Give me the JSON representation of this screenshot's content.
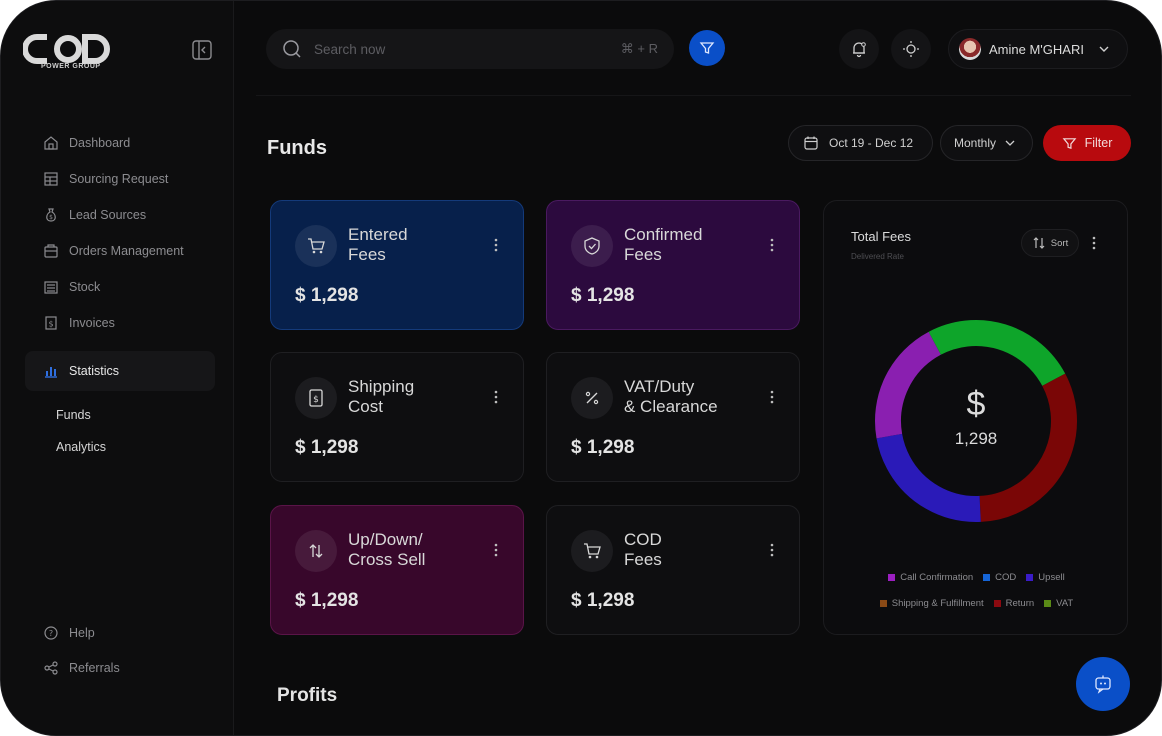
{
  "brand": {
    "logo_text": "COD",
    "logo_sub": "POWER GROUP"
  },
  "sidebar": {
    "items": [
      {
        "label": "Dashboard",
        "icon": "home-icon"
      },
      {
        "label": "Sourcing Request",
        "icon": "table-icon"
      },
      {
        "label": "Lead Sources",
        "icon": "money-bag-icon"
      },
      {
        "label": "Orders Management",
        "icon": "box-icon"
      },
      {
        "label": "Stock",
        "icon": "stock-icon"
      },
      {
        "label": "Invoices",
        "icon": "invoice-icon"
      },
      {
        "label": "Statistics",
        "icon": "chart-icon",
        "active": true
      }
    ],
    "sub_items": [
      {
        "label": "Funds"
      },
      {
        "label": "Analytics"
      }
    ],
    "footer_items": [
      {
        "label": "Help",
        "icon": "help-icon"
      },
      {
        "label": "Referrals",
        "icon": "share-icon"
      }
    ]
  },
  "header": {
    "search_placeholder": "Search now",
    "search_shortcut": "⌘ + R",
    "user_name": "Amine M'GHARI"
  },
  "funds": {
    "title": "Funds",
    "date_range": "Oct 19 - Dec 12",
    "period": "Monthly",
    "filter_label": "Filter"
  },
  "cards": [
    {
      "title_line1": "Entered",
      "title_line2": "Fees",
      "value": "$ 1,298",
      "icon": "cart-icon"
    },
    {
      "title_line1": "Confirmed",
      "title_line2": "Fees",
      "value": "$ 1,298",
      "icon": "shield-check-icon"
    },
    {
      "title_line1": "Shipping",
      "title_line2": "Cost",
      "value": "$ 1,298",
      "icon": "receipt-icon"
    },
    {
      "title_line1": "VAT/Duty",
      "title_line2": "& Clearance",
      "value": "$ 1,298",
      "icon": "percent-icon"
    },
    {
      "title_line1": "Up/Down/",
      "title_line2": "Cross Sell",
      "value": "$ 1,298",
      "icon": "arrows-updown-icon"
    },
    {
      "title_line1": "COD",
      "title_line2": "Fees",
      "value": "$ 1,298",
      "icon": "cart-icon"
    }
  ],
  "total_fees": {
    "title": "Total Fees",
    "subtitle": "Delivered Rate",
    "sort_label": "Sort",
    "center_symbol": "$",
    "center_value": "1,298"
  },
  "chart_data": {
    "type": "pie",
    "title": "Total Fees",
    "categories": [
      "Call Confirmation",
      "COD",
      "Upsell",
      "Shipping & Fulfillment",
      "Return",
      "VAT"
    ],
    "legend_colors": [
      "#9b1fc0",
      "#1565d8",
      "#3a1cc8",
      "#8a4a16",
      "#8b0a10",
      "#5a8a16"
    ],
    "donut_segments": [
      {
        "name": "green",
        "value": 25,
        "color": "#0ea52a"
      },
      {
        "name": "dark-red",
        "value": 32,
        "color": "#7a0606"
      },
      {
        "name": "indigo",
        "value": 23,
        "color": "#2a1ab8"
      },
      {
        "name": "purple",
        "value": 20,
        "color": "#8a1fb0"
      }
    ]
  },
  "profits": {
    "title": "Profits"
  }
}
